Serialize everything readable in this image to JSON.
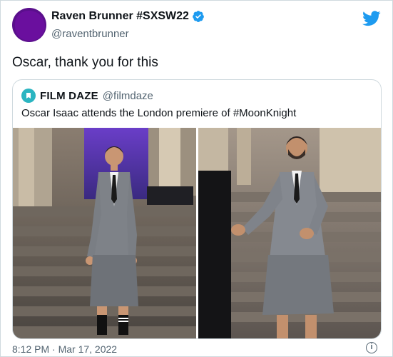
{
  "tweet": {
    "author": {
      "display_name": "Raven Brunner #SXSW22",
      "handle": "@raventbrunner",
      "verified": true
    },
    "text": "Oscar, thank you for this",
    "timestamp": "8:12 PM · Mar 17, 2022"
  },
  "quoted_tweet": {
    "author": {
      "display_name": "FILM DAZE",
      "handle": "@filmdaze"
    },
    "text": "Oscar Isaac attends the London premiere of #MoonKnight",
    "media_count": 2
  },
  "icons": {
    "brand": "twitter-bird-icon",
    "verified": "verified-badge-icon",
    "info": "info-icon"
  },
  "colors": {
    "brand_blue": "#1d9bf0",
    "secondary_text": "#536471",
    "border": "#cfd9de",
    "quote_avatar": "#2bb5c1",
    "author_avatar": "#5a0f8c"
  }
}
